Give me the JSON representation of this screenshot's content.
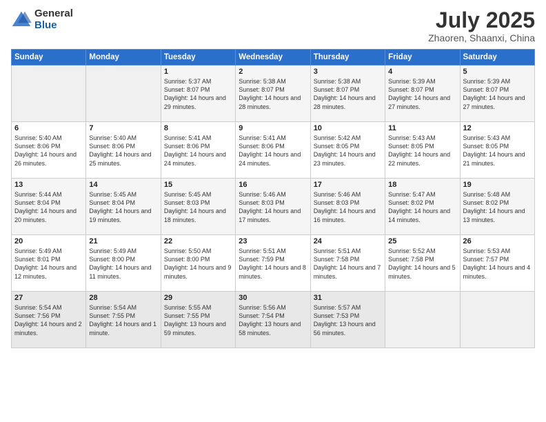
{
  "header": {
    "logo_general": "General",
    "logo_blue": "Blue",
    "month": "July 2025",
    "location": "Zhaoren, Shaanxi, China"
  },
  "weekdays": [
    "Sunday",
    "Monday",
    "Tuesday",
    "Wednesday",
    "Thursday",
    "Friday",
    "Saturday"
  ],
  "weeks": [
    [
      {
        "day": "",
        "sunrise": "",
        "sunset": "",
        "daylight": ""
      },
      {
        "day": "",
        "sunrise": "",
        "sunset": "",
        "daylight": ""
      },
      {
        "day": "1",
        "sunrise": "Sunrise: 5:37 AM",
        "sunset": "Sunset: 8:07 PM",
        "daylight": "Daylight: 14 hours and 29 minutes."
      },
      {
        "day": "2",
        "sunrise": "Sunrise: 5:38 AM",
        "sunset": "Sunset: 8:07 PM",
        "daylight": "Daylight: 14 hours and 28 minutes."
      },
      {
        "day": "3",
        "sunrise": "Sunrise: 5:38 AM",
        "sunset": "Sunset: 8:07 PM",
        "daylight": "Daylight: 14 hours and 28 minutes."
      },
      {
        "day": "4",
        "sunrise": "Sunrise: 5:39 AM",
        "sunset": "Sunset: 8:07 PM",
        "daylight": "Daylight: 14 hours and 27 minutes."
      },
      {
        "day": "5",
        "sunrise": "Sunrise: 5:39 AM",
        "sunset": "Sunset: 8:07 PM",
        "daylight": "Daylight: 14 hours and 27 minutes."
      }
    ],
    [
      {
        "day": "6",
        "sunrise": "Sunrise: 5:40 AM",
        "sunset": "Sunset: 8:06 PM",
        "daylight": "Daylight: 14 hours and 26 minutes."
      },
      {
        "day": "7",
        "sunrise": "Sunrise: 5:40 AM",
        "sunset": "Sunset: 8:06 PM",
        "daylight": "Daylight: 14 hours and 25 minutes."
      },
      {
        "day": "8",
        "sunrise": "Sunrise: 5:41 AM",
        "sunset": "Sunset: 8:06 PM",
        "daylight": "Daylight: 14 hours and 24 minutes."
      },
      {
        "day": "9",
        "sunrise": "Sunrise: 5:41 AM",
        "sunset": "Sunset: 8:06 PM",
        "daylight": "Daylight: 14 hours and 24 minutes."
      },
      {
        "day": "10",
        "sunrise": "Sunrise: 5:42 AM",
        "sunset": "Sunset: 8:05 PM",
        "daylight": "Daylight: 14 hours and 23 minutes."
      },
      {
        "day": "11",
        "sunrise": "Sunrise: 5:43 AM",
        "sunset": "Sunset: 8:05 PM",
        "daylight": "Daylight: 14 hours and 22 minutes."
      },
      {
        "day": "12",
        "sunrise": "Sunrise: 5:43 AM",
        "sunset": "Sunset: 8:05 PM",
        "daylight": "Daylight: 14 hours and 21 minutes."
      }
    ],
    [
      {
        "day": "13",
        "sunrise": "Sunrise: 5:44 AM",
        "sunset": "Sunset: 8:04 PM",
        "daylight": "Daylight: 14 hours and 20 minutes."
      },
      {
        "day": "14",
        "sunrise": "Sunrise: 5:45 AM",
        "sunset": "Sunset: 8:04 PM",
        "daylight": "Daylight: 14 hours and 19 minutes."
      },
      {
        "day": "15",
        "sunrise": "Sunrise: 5:45 AM",
        "sunset": "Sunset: 8:03 PM",
        "daylight": "Daylight: 14 hours and 18 minutes."
      },
      {
        "day": "16",
        "sunrise": "Sunrise: 5:46 AM",
        "sunset": "Sunset: 8:03 PM",
        "daylight": "Daylight: 14 hours and 17 minutes."
      },
      {
        "day": "17",
        "sunrise": "Sunrise: 5:46 AM",
        "sunset": "Sunset: 8:03 PM",
        "daylight": "Daylight: 14 hours and 16 minutes."
      },
      {
        "day": "18",
        "sunrise": "Sunrise: 5:47 AM",
        "sunset": "Sunset: 8:02 PM",
        "daylight": "Daylight: 14 hours and 14 minutes."
      },
      {
        "day": "19",
        "sunrise": "Sunrise: 5:48 AM",
        "sunset": "Sunset: 8:02 PM",
        "daylight": "Daylight: 14 hours and 13 minutes."
      }
    ],
    [
      {
        "day": "20",
        "sunrise": "Sunrise: 5:49 AM",
        "sunset": "Sunset: 8:01 PM",
        "daylight": "Daylight: 14 hours and 12 minutes."
      },
      {
        "day": "21",
        "sunrise": "Sunrise: 5:49 AM",
        "sunset": "Sunset: 8:00 PM",
        "daylight": "Daylight: 14 hours and 11 minutes."
      },
      {
        "day": "22",
        "sunrise": "Sunrise: 5:50 AM",
        "sunset": "Sunset: 8:00 PM",
        "daylight": "Daylight: 14 hours and 9 minutes."
      },
      {
        "day": "23",
        "sunrise": "Sunrise: 5:51 AM",
        "sunset": "Sunset: 7:59 PM",
        "daylight": "Daylight: 14 hours and 8 minutes."
      },
      {
        "day": "24",
        "sunrise": "Sunrise: 5:51 AM",
        "sunset": "Sunset: 7:58 PM",
        "daylight": "Daylight: 14 hours and 7 minutes."
      },
      {
        "day": "25",
        "sunrise": "Sunrise: 5:52 AM",
        "sunset": "Sunset: 7:58 PM",
        "daylight": "Daylight: 14 hours and 5 minutes."
      },
      {
        "day": "26",
        "sunrise": "Sunrise: 5:53 AM",
        "sunset": "Sunset: 7:57 PM",
        "daylight": "Daylight: 14 hours and 4 minutes."
      }
    ],
    [
      {
        "day": "27",
        "sunrise": "Sunrise: 5:54 AM",
        "sunset": "Sunset: 7:56 PM",
        "daylight": "Daylight: 14 hours and 2 minutes."
      },
      {
        "day": "28",
        "sunrise": "Sunrise: 5:54 AM",
        "sunset": "Sunset: 7:55 PM",
        "daylight": "Daylight: 14 hours and 1 minute."
      },
      {
        "day": "29",
        "sunrise": "Sunrise: 5:55 AM",
        "sunset": "Sunset: 7:55 PM",
        "daylight": "Daylight: 13 hours and 59 minutes."
      },
      {
        "day": "30",
        "sunrise": "Sunrise: 5:56 AM",
        "sunset": "Sunset: 7:54 PM",
        "daylight": "Daylight: 13 hours and 58 minutes."
      },
      {
        "day": "31",
        "sunrise": "Sunrise: 5:57 AM",
        "sunset": "Sunset: 7:53 PM",
        "daylight": "Daylight: 13 hours and 56 minutes."
      },
      {
        "day": "",
        "sunrise": "",
        "sunset": "",
        "daylight": ""
      },
      {
        "day": "",
        "sunrise": "",
        "sunset": "",
        "daylight": ""
      }
    ]
  ]
}
